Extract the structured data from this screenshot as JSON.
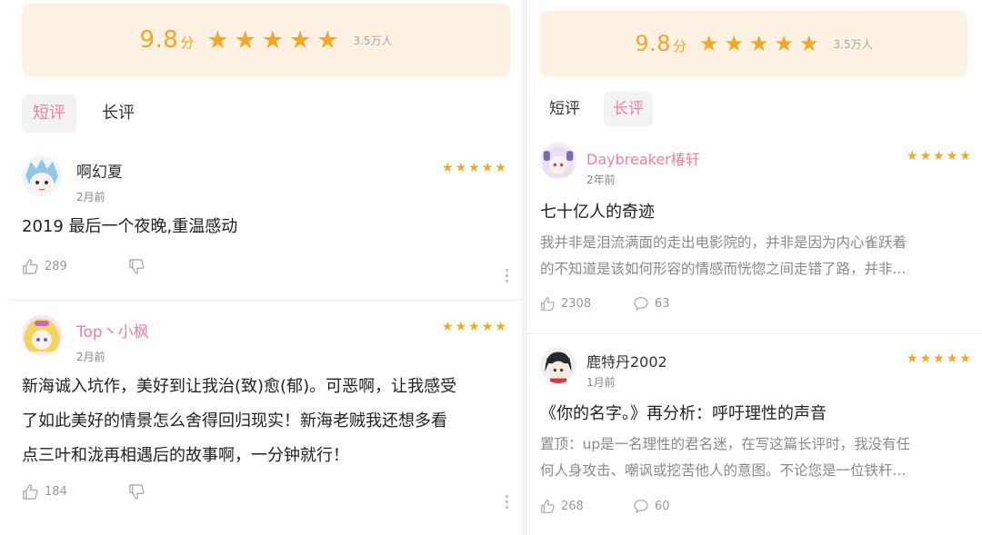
{
  "left": {
    "rating": {
      "score": "9.8",
      "unit": "分",
      "votes": "3.5万人",
      "stars": 5
    },
    "tabs": [
      {
        "label": "短评",
        "active": true
      },
      {
        "label": "长评",
        "active": false
      }
    ],
    "reviews": [
      {
        "user": "啊幻夏",
        "date": "2月前",
        "stars": 5,
        "content": "2019 最后一个夜晚,重温感动",
        "likes": "289"
      },
      {
        "user": "Top丶小枫",
        "date": "2月前",
        "stars": 5,
        "content_lines": [
          "新海诚入坑作，美好到让我治(致)愈(郁)。可恶啊，让我感受",
          "了如此美好的情景怎么舍得回归现实！新海老贼我还想多看",
          "点三叶和泷再相遇后的故事啊，一分钟就行！"
        ],
        "likes": "184"
      }
    ]
  },
  "right": {
    "rating": {
      "score": "9.8",
      "unit": "分",
      "votes": "3.5万人",
      "stars": 5
    },
    "tabs": [
      {
        "label": "短评",
        "active": false
      },
      {
        "label": "长评",
        "active": true
      }
    ],
    "reviews": [
      {
        "user": "Daybreaker椿轩",
        "date": "2年前",
        "stars": 5,
        "title": "七十亿人的奇迹",
        "excerpt_lines": [
          "我并非是泪流满面的走出电影院的，并非是因为内心雀跃着",
          "的不知道是该如何形容的情感而恍惚之间走错了路，并非..."
        ],
        "likes": "2308",
        "comments": "63"
      },
      {
        "user": "鹿特丹2002",
        "date": "1月前",
        "stars": 5,
        "title": "《你的名字。》再分析：呼吁理性的声音",
        "excerpt_lines": [
          "置顶：up是一名理性的君名迷，在写这篇长评时，我没有任",
          "何人身攻击、嘲讽或挖苦他人的意图。不论您是一位铁杆..."
        ],
        "likes": "268",
        "comments": "60"
      }
    ]
  },
  "colors": {
    "accent_pink": "#ee7fa6",
    "star_orange": "#f5a623",
    "rating_bg": "#fdf1e4"
  },
  "icons": [
    "star-icon",
    "thumb-up-icon",
    "thumb-down-icon",
    "comment-icon",
    "more-icon"
  ]
}
